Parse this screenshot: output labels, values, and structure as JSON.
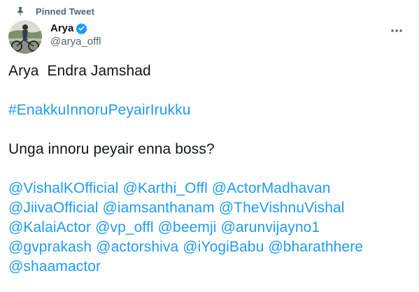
{
  "pinned": {
    "label": "Pinned Tweet",
    "icon": "pin-icon"
  },
  "author": {
    "display_name": "Arya",
    "handle": "@arya_offl",
    "verified": true,
    "verified_icon": "verified-badge-icon",
    "avatar_icon": "avatar-photo"
  },
  "more_icon": "more-dots-icon",
  "tweet": {
    "line1": "Arya  Endra Jamshad",
    "hashtag": "#EnakkuInnoruPeyairIrukku",
    "question": "Unga innoru peyair enna boss?",
    "mentions": [
      [
        "@VishalKOfficial",
        "@Karthi_Offl",
        "@ActorMadhavan"
      ],
      [
        "@JiivaOfficial",
        "@iamsanthanam",
        "@TheVishnuVishal"
      ],
      [
        "@KalaiActor",
        "@vp_offl",
        "@beemji",
        "@arunvijayno1"
      ],
      [
        "@gvprakash",
        "@actorshiva",
        "@iYogiBabu",
        "@bharathhere"
      ],
      [
        "@shaamactor"
      ]
    ]
  },
  "colors": {
    "link": "#1d9bf0",
    "text": "#0f1419",
    "secondary": "#536471"
  }
}
